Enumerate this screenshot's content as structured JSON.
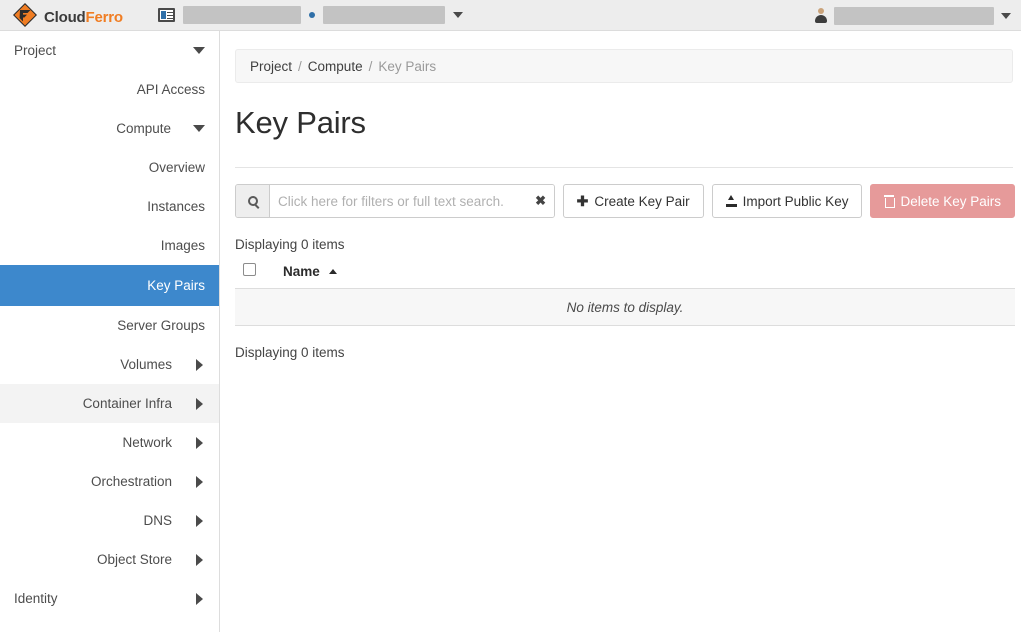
{
  "topbar": {
    "brand_cloud": "Cloud",
    "brand_ferro": "Ferro",
    "project_selector_icon": "list-card-icon",
    "project_value": "",
    "region_value": "",
    "user_icon": "user-icon",
    "user_value": "",
    "accent_orange": "#f07d23",
    "background": "#ededed"
  },
  "sidebar": {
    "items": [
      {
        "label": "Project",
        "level": 0,
        "chevron": "down",
        "state": "normal"
      },
      {
        "label": "API Access",
        "level": 2,
        "chevron": "none",
        "state": "normal"
      },
      {
        "label": "Compute",
        "level": 1,
        "chevron": "down",
        "state": "normal"
      },
      {
        "label": "Overview",
        "level": 2,
        "chevron": "none",
        "state": "normal"
      },
      {
        "label": "Instances",
        "level": 2,
        "chevron": "none",
        "state": "normal"
      },
      {
        "label": "Images",
        "level": 2,
        "chevron": "none",
        "state": "normal"
      },
      {
        "label": "Key Pairs",
        "level": 2,
        "chevron": "none",
        "state": "active"
      },
      {
        "label": "Server Groups",
        "level": 2,
        "chevron": "none",
        "state": "normal"
      },
      {
        "label": "Volumes",
        "level": 1,
        "chevron": "right",
        "state": "normal"
      },
      {
        "label": "Container Infra",
        "level": 1,
        "chevron": "right",
        "state": "hover"
      },
      {
        "label": "Network",
        "level": 1,
        "chevron": "right",
        "state": "normal"
      },
      {
        "label": "Orchestration",
        "level": 1,
        "chevron": "right",
        "state": "normal"
      },
      {
        "label": "DNS",
        "level": 1,
        "chevron": "right",
        "state": "normal"
      },
      {
        "label": "Object Store",
        "level": 1,
        "chevron": "right",
        "state": "normal"
      },
      {
        "label": "Identity",
        "level": 0,
        "chevron": "right",
        "state": "normal"
      }
    ],
    "active_color": "#3d88cc",
    "hover_color": "#f3f3f3"
  },
  "breadcrumb": {
    "item1": "Project",
    "sep1": "/",
    "item2": "Compute",
    "sep2": "/",
    "current": "Key Pairs"
  },
  "page": {
    "title": "Key Pairs"
  },
  "toolbar": {
    "search_placeholder": "Click here for filters or full text search.",
    "search_value": "",
    "search_icon": "search-icon",
    "clear_icon": "✖",
    "create_label": "Create Key Pair",
    "create_icon": "plus-icon",
    "import_label": "Import Public Key",
    "import_icon": "upload-icon",
    "delete_label": "Delete Key Pairs",
    "delete_icon": "trash-icon",
    "delete_color": "#e69a9a"
  },
  "table": {
    "count_top": "Displaying 0 items",
    "count_bottom": "Displaying 0 items",
    "columns": [
      {
        "label": "",
        "type": "checkbox"
      },
      {
        "label": "Name",
        "sort": "asc"
      }
    ],
    "empty_message": "No items to display.",
    "rows": []
  }
}
